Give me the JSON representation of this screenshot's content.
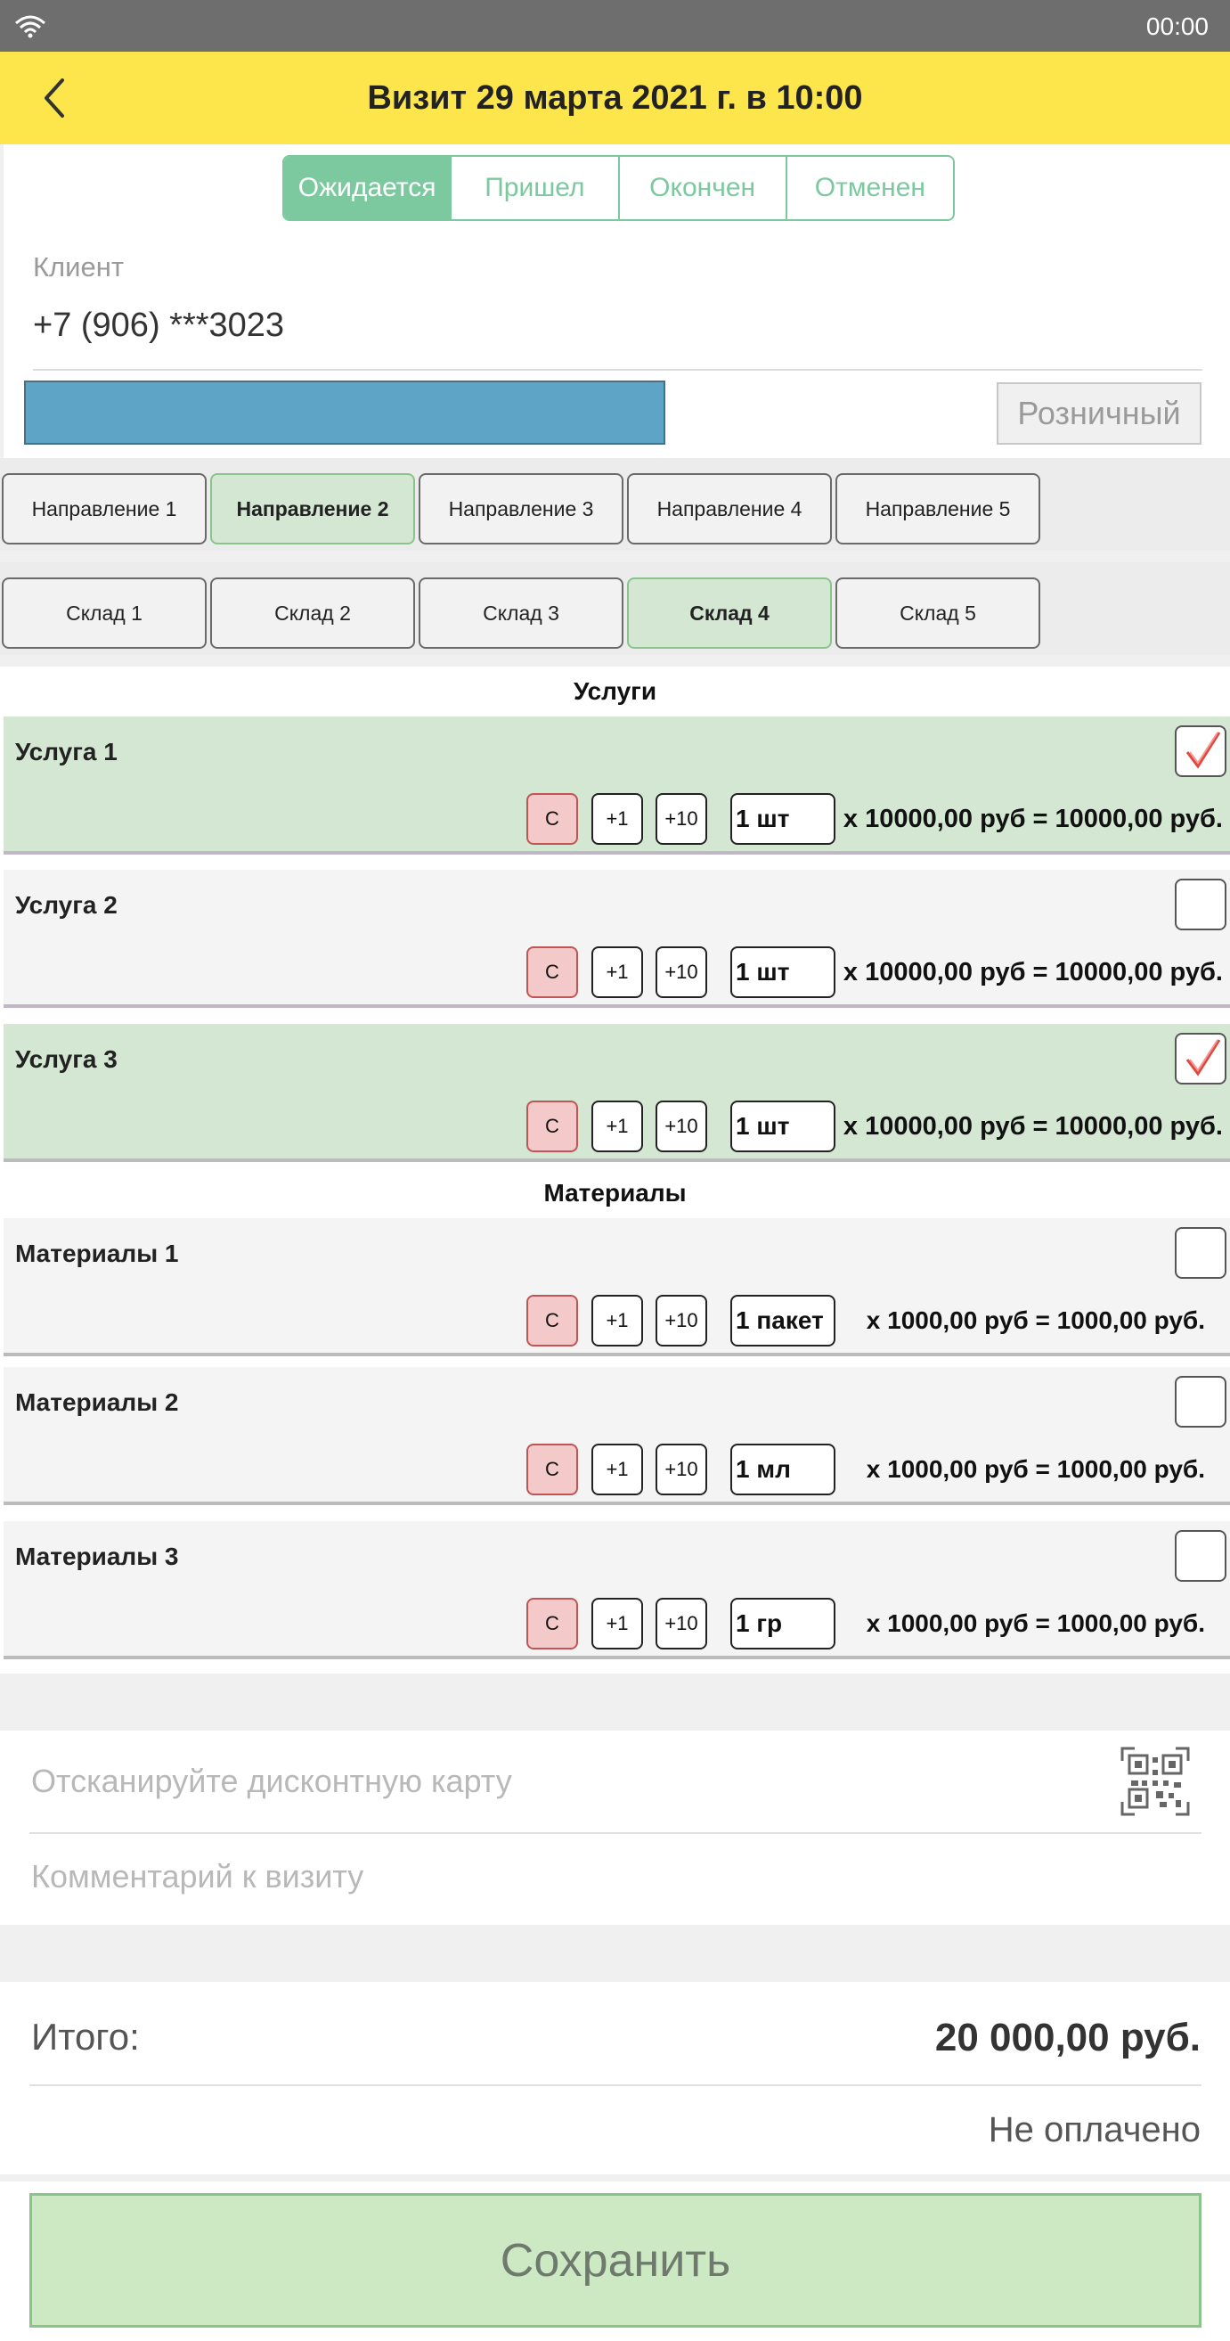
{
  "status_bar": {
    "time": "00:00",
    "wifi_icon": "wifi-icon"
  },
  "header": {
    "title": "Визит 29 марта 2021 г. в 10:00",
    "back_icon": "chevron-left-icon",
    "color": "#fde64b"
  },
  "status_tabs": [
    {
      "label": "Ожидается",
      "active": true
    },
    {
      "label": "Пришел",
      "active": false
    },
    {
      "label": "Окончен",
      "active": false
    },
    {
      "label": "Отменен",
      "active": false
    }
  ],
  "client": {
    "label": "Клиент",
    "phone": "+7 (906) ***3023",
    "price_type": "Розничный"
  },
  "directions": [
    {
      "label": "Направление 1",
      "active": false
    },
    {
      "label": "Направление 2",
      "active": true
    },
    {
      "label": "Направление 3",
      "active": false
    },
    {
      "label": "Направление 4",
      "active": false
    },
    {
      "label": "Направление 5",
      "active": false
    }
  ],
  "warehouses": [
    {
      "label": "Склад 1",
      "active": false
    },
    {
      "label": "Склад 2",
      "active": false
    },
    {
      "label": "Склад 3",
      "active": false
    },
    {
      "label": "Склад 4",
      "active": true
    },
    {
      "label": "Склад 5",
      "active": false
    }
  ],
  "services": {
    "title": "Услуги",
    "items": [
      {
        "name": "Услуга 1",
        "checked": true,
        "clear": "С",
        "plus1": "+1",
        "plus10": "+10",
        "qty": "1 шт",
        "price": "x 10000,00 руб = 10000,00 руб."
      },
      {
        "name": "Услуга 2",
        "checked": false,
        "clear": "С",
        "plus1": "+1",
        "plus10": "+10",
        "qty": "1 шт",
        "price": "x 10000,00 руб = 10000,00 руб."
      },
      {
        "name": "Услуга 3",
        "checked": true,
        "clear": "С",
        "plus1": "+1",
        "plus10": "+10",
        "qty": "1 шт",
        "price": "x 10000,00 руб = 10000,00 руб."
      }
    ]
  },
  "materials": {
    "title": "Материалы",
    "items": [
      {
        "name": "Материалы 1",
        "checked": false,
        "clear": "С",
        "plus1": "+1",
        "plus10": "+10",
        "qty": "1 пакет",
        "price": "x 1000,00 руб = 1000,00 руб."
      },
      {
        "name": "Материалы 2",
        "checked": false,
        "clear": "С",
        "plus1": "+1",
        "plus10": "+10",
        "qty": "1 мл",
        "price": "x 1000,00 руб = 1000,00 руб."
      },
      {
        "name": "Материалы 3",
        "checked": false,
        "clear": "С",
        "plus1": "+1",
        "plus10": "+10",
        "qty": "1 гр",
        "price": "x 1000,00 руб = 1000,00 руб."
      }
    ]
  },
  "discount": {
    "placeholder": "Отсканируйте дисконтную карту",
    "icon": "qr-code-icon"
  },
  "comment": {
    "placeholder": "Комментарий к визиту"
  },
  "total": {
    "label": "Итого:",
    "value": "20 000,00 руб.",
    "payment_status": "Не оплачено"
  },
  "save_label": "Сохранить"
}
